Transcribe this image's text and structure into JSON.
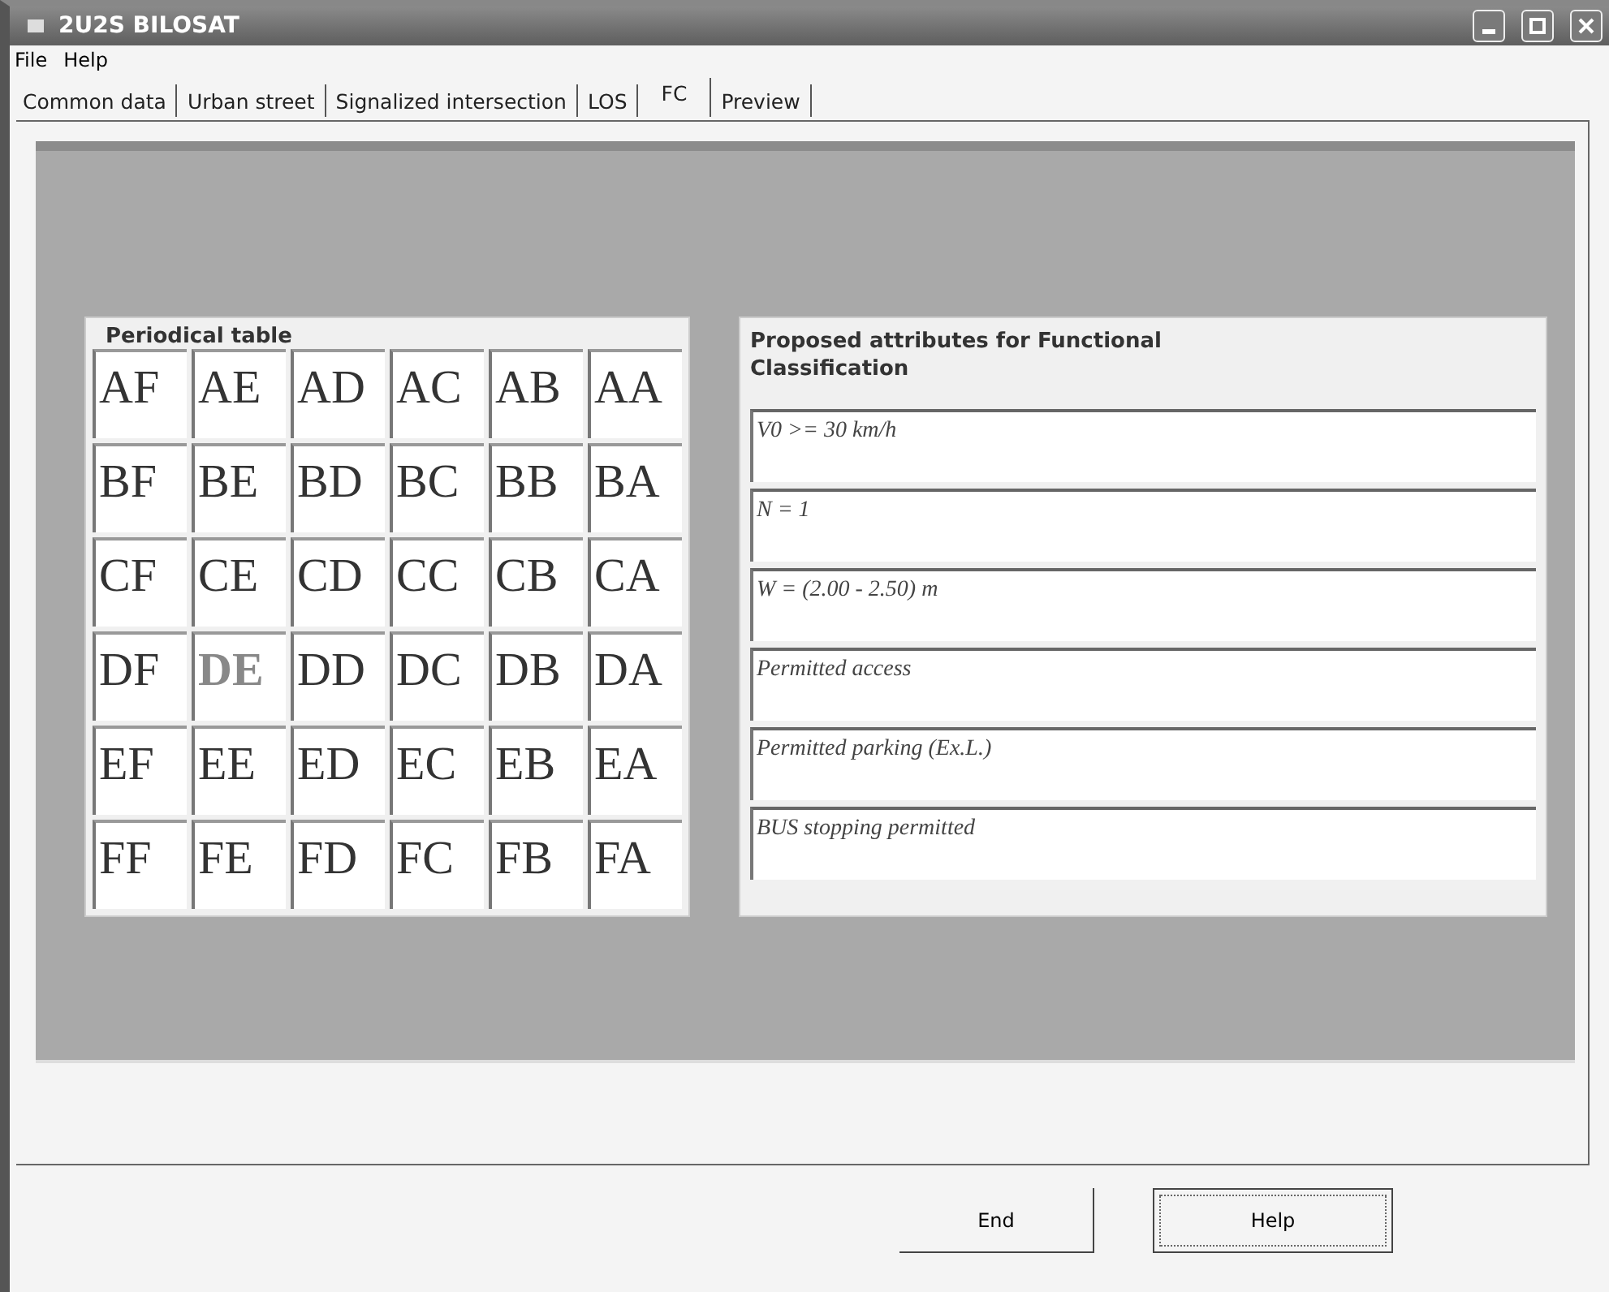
{
  "window": {
    "title": "2U2S BILOSAT"
  },
  "menu": [
    "File",
    "Help"
  ],
  "tabs": [
    {
      "label": "Common data",
      "selected": false
    },
    {
      "label": "Urban street",
      "selected": false
    },
    {
      "label": "Signalized intersection",
      "selected": false
    },
    {
      "label": "LOS",
      "selected": false
    },
    {
      "label": "FC",
      "selected": true
    },
    {
      "label": "Preview",
      "selected": false
    }
  ],
  "periodical_table": {
    "title": "Periodical table",
    "rows": [
      [
        {
          "label": "AF",
          "selected": false
        },
        {
          "label": "AE",
          "selected": false
        },
        {
          "label": "AD",
          "selected": false
        },
        {
          "label": "AC",
          "selected": false
        },
        {
          "label": "AB",
          "selected": false
        },
        {
          "label": "AA",
          "selected": false
        }
      ],
      [
        {
          "label": "BF",
          "selected": false
        },
        {
          "label": "BE",
          "selected": false
        },
        {
          "label": "BD",
          "selected": false
        },
        {
          "label": "BC",
          "selected": false
        },
        {
          "label": "BB",
          "selected": false
        },
        {
          "label": "BA",
          "selected": false
        }
      ],
      [
        {
          "label": "CF",
          "selected": false
        },
        {
          "label": "CE",
          "selected": false
        },
        {
          "label": "CD",
          "selected": false
        },
        {
          "label": "CC",
          "selected": false
        },
        {
          "label": "CB",
          "selected": false
        },
        {
          "label": "CA",
          "selected": false
        }
      ],
      [
        {
          "label": "DF",
          "selected": false
        },
        {
          "label": "DE",
          "selected": true
        },
        {
          "label": "DD",
          "selected": false
        },
        {
          "label": "DC",
          "selected": false
        },
        {
          "label": "DB",
          "selected": false
        },
        {
          "label": "DA",
          "selected": false
        }
      ],
      [
        {
          "label": "EF",
          "selected": false
        },
        {
          "label": "EE",
          "selected": false
        },
        {
          "label": "ED",
          "selected": false
        },
        {
          "label": "EC",
          "selected": false
        },
        {
          "label": "EB",
          "selected": false
        },
        {
          "label": "EA",
          "selected": false
        }
      ],
      [
        {
          "label": "FF",
          "selected": false
        },
        {
          "label": "FE",
          "selected": false
        },
        {
          "label": "FD",
          "selected": false
        },
        {
          "label": "FC",
          "selected": false
        },
        {
          "label": "FB",
          "selected": false
        },
        {
          "label": "FA",
          "selected": false
        }
      ]
    ]
  },
  "attributes": {
    "title": "Proposed attributes for Functional Classification",
    "items": [
      "V0 >= 30 km/h",
      "N = 1",
      "W = (2.00 - 2.50) m",
      "Permitted access",
      "Permitted parking (Ex.L.)",
      "BUS stopping permitted"
    ]
  },
  "buttons": [
    "End",
    "Help"
  ]
}
